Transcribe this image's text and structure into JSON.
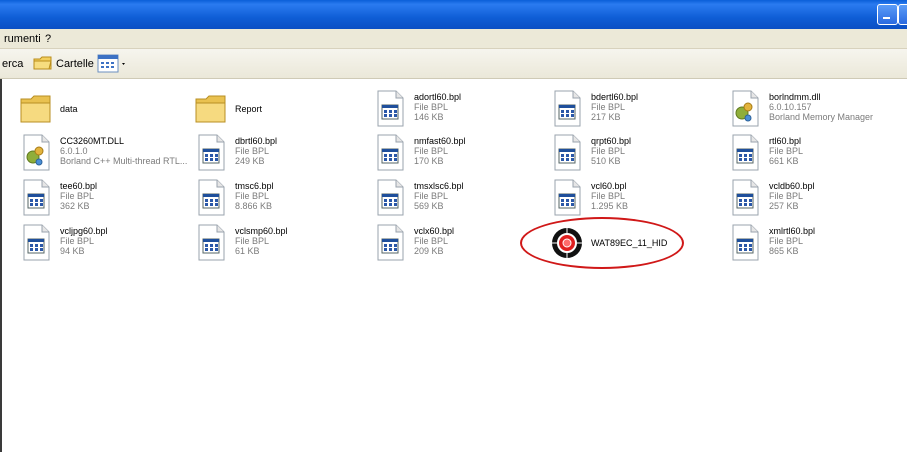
{
  "window": {
    "title": ""
  },
  "menu": {
    "items": [
      "rumenti",
      "?"
    ]
  },
  "toolbar": {
    "search_label": "erca",
    "folders_label": "Cartelle"
  },
  "files": [
    {
      "name": "data",
      "type": "",
      "size": "",
      "icon": "folder-icon"
    },
    {
      "name": "Report",
      "type": "",
      "size": "",
      "icon": "folder-icon"
    },
    {
      "name": "adortl60.bpl",
      "type": "File BPL",
      "size": "146 KB",
      "icon": "bpl-file-icon"
    },
    {
      "name": "bdertl60.bpl",
      "type": "File BPL",
      "size": "217 KB",
      "icon": "bpl-file-icon"
    },
    {
      "name": "borlndmm.dll",
      "type": "6.0.10.157",
      "size": "Borland Memory Manager",
      "icon": "dll-file-icon"
    },
    {
      "name": "CC3260MT.DLL",
      "type": "6.0.1.0",
      "size": "Borland C++ Multi-thread RTL...",
      "icon": "dll-file-icon"
    },
    {
      "name": "dbrtl60.bpl",
      "type": "File BPL",
      "size": "249 KB",
      "icon": "bpl-file-icon"
    },
    {
      "name": "nmfast60.bpl",
      "type": "File BPL",
      "size": "170 KB",
      "icon": "bpl-file-icon"
    },
    {
      "name": "qrpt60.bpl",
      "type": "File BPL",
      "size": "510 KB",
      "icon": "bpl-file-icon"
    },
    {
      "name": "rtl60.bpl",
      "type": "File BPL",
      "size": "661 KB",
      "icon": "bpl-file-icon"
    },
    {
      "name": "tee60.bpl",
      "type": "File BPL",
      "size": "362 KB",
      "icon": "bpl-file-icon"
    },
    {
      "name": "tmsc6.bpl",
      "type": "File BPL",
      "size": "8.866 KB",
      "icon": "bpl-file-icon"
    },
    {
      "name": "tmsxlsc6.bpl",
      "type": "File BPL",
      "size": "569 KB",
      "icon": "bpl-file-icon"
    },
    {
      "name": "vcl60.bpl",
      "type": "File BPL",
      "size": "1.295 KB",
      "icon": "bpl-file-icon"
    },
    {
      "name": "vcldb60.bpl",
      "type": "File BPL",
      "size": "257 KB",
      "icon": "bpl-file-icon"
    },
    {
      "name": "vcljpg60.bpl",
      "type": "File BPL",
      "size": "94 KB",
      "icon": "bpl-file-icon"
    },
    {
      "name": "vclsmp60.bpl",
      "type": "File BPL",
      "size": "61 KB",
      "icon": "bpl-file-icon"
    },
    {
      "name": "vclx60.bpl",
      "type": "File BPL",
      "size": "209 KB",
      "icon": "bpl-file-icon"
    },
    {
      "name": "WAT89EC_11_HID",
      "type": "",
      "size": "",
      "icon": "target-exe-icon"
    },
    {
      "name": "xmlrtl60.bpl",
      "type": "File BPL",
      "size": "865 KB",
      "icon": "bpl-file-icon"
    }
  ],
  "colors": {
    "titlebar": "#0b4fc4",
    "highlight": "#d01818",
    "subtext": "#7b7b7b"
  }
}
